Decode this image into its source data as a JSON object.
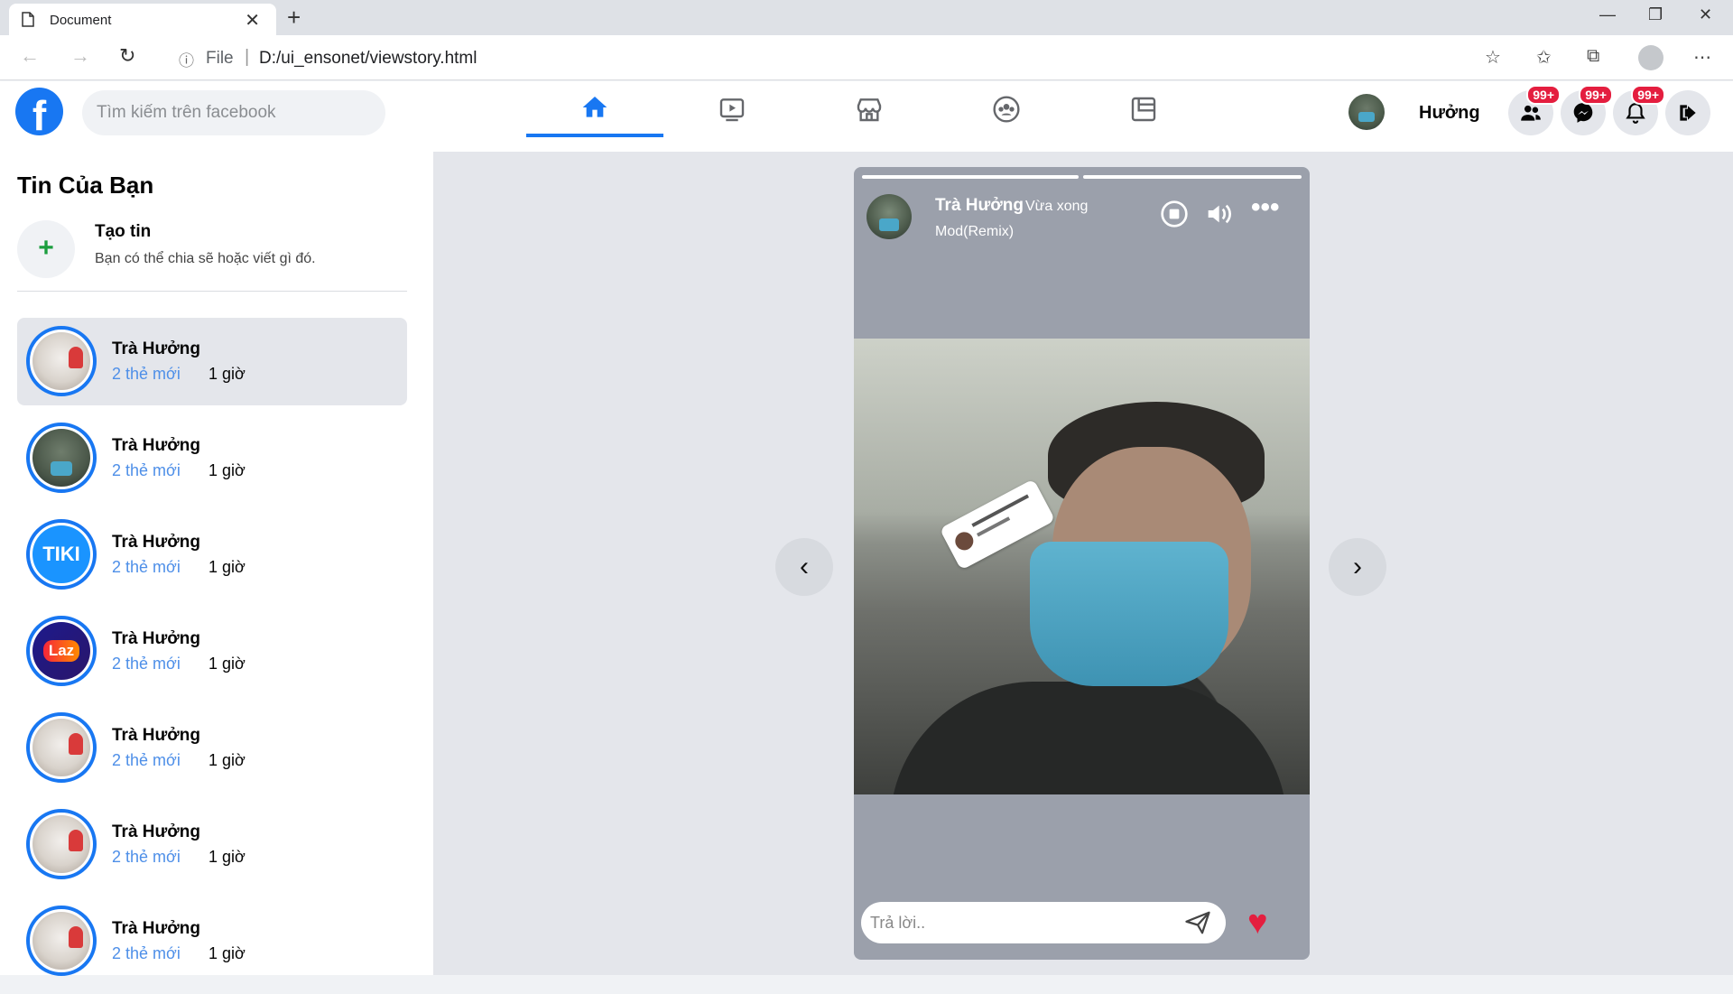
{
  "browser": {
    "tab_title": "Document",
    "url_scheme": "File",
    "url": "D:/ui_ensonet/viewstory.html"
  },
  "header": {
    "search_placeholder": "Tìm kiếm trên facebook",
    "user_name": "Hưởng",
    "badges": {
      "friends": "99+",
      "messenger": "99+",
      "notifications": "99+"
    },
    "nav_tabs": [
      "home-icon",
      "video-icon",
      "marketplace-icon",
      "groups-icon",
      "gaming-icon"
    ],
    "accent": "#1877f2"
  },
  "sidebar": {
    "title": "Tin Của Bạn",
    "create_title": "Tạo tin",
    "create_subtitle": "Bạn có thể chia sẽ hoặc viết gì đó.",
    "stories": [
      {
        "name": "Trà Hưởng",
        "new_count": "2 thẻ mới",
        "time": "1 giờ",
        "avatar": "cat"
      },
      {
        "name": "Trà Hưởng",
        "new_count": "2 thẻ mới",
        "time": "1 giờ",
        "avatar": "man"
      },
      {
        "name": "Trà Hưởng",
        "new_count": "2 thẻ mới",
        "time": "1 giờ",
        "avatar": "tiki",
        "avatar_text": "TIKI"
      },
      {
        "name": "Trà Hưởng",
        "new_count": "2 thẻ mới",
        "time": "1 giờ",
        "avatar": "laz",
        "avatar_text": "Laz"
      },
      {
        "name": "Trà Hưởng",
        "new_count": "2 thẻ mới",
        "time": "1 giờ",
        "avatar": "cat"
      },
      {
        "name": "Trà Hưởng",
        "new_count": "2 thẻ mới",
        "time": "1 giờ",
        "avatar": "cat"
      },
      {
        "name": "Trà Hưởng",
        "new_count": "2 thẻ mới",
        "time": "1 giờ",
        "avatar": "cat"
      }
    ]
  },
  "story": {
    "author": "Trà Hưởng",
    "time": "Vừa xong",
    "music": "Mod(Remix)",
    "reply_placeholder": "Trả lời..",
    "progress_segments": 2
  }
}
